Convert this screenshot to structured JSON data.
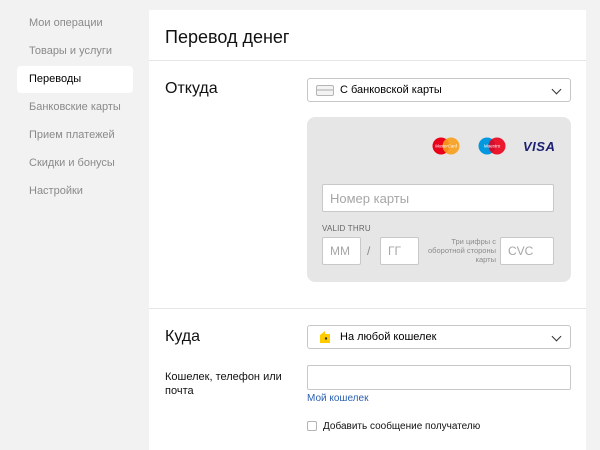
{
  "sidebar": {
    "items": [
      {
        "label": "Мои операции",
        "active": false
      },
      {
        "label": "Товары и услуги",
        "active": false
      },
      {
        "label": "Переводы",
        "active": true
      },
      {
        "label": "Банковские карты",
        "active": false
      },
      {
        "label": "Прием платежей",
        "active": false
      },
      {
        "label": "Скидки и бонусы",
        "active": false
      },
      {
        "label": "Настройки",
        "active": false
      }
    ]
  },
  "main": {
    "title": "Перевод денег",
    "from": {
      "label": "Откуда",
      "source_select": "С банковской карты",
      "brands": {
        "mastercard": "MasterCard",
        "maestro": "Maestro",
        "visa": "VISA"
      },
      "card_number_placeholder": "Номер карты",
      "valid_thru": "VALID THRU",
      "month_placeholder": "ММ",
      "date_separator": "/",
      "year_placeholder": "ГГ",
      "cvc_hint": "Три цифры с оборотной стороны карты",
      "cvc_placeholder": "CVC"
    },
    "to": {
      "label": "Куда",
      "destination_select": "На любой кошелек",
      "wallet_label": "Кошелек, телефон или почта",
      "wallet_value": "",
      "my_wallet_link": "Мой кошелек",
      "add_message_label": "Добавить сообщение получателю",
      "add_message_checked": false
    }
  },
  "colors": {
    "page_bg": "#f2f2f2",
    "panel_bg": "#e6e6e6",
    "link": "#2a5fb0",
    "wallet_yellow": "#ffcc00",
    "mastercard_red": "#eb001b",
    "mastercard_orange": "#f79e1b",
    "maestro_blue": "#0099df",
    "maestro_red": "#eb001b",
    "visa_blue": "#1a1f71"
  }
}
